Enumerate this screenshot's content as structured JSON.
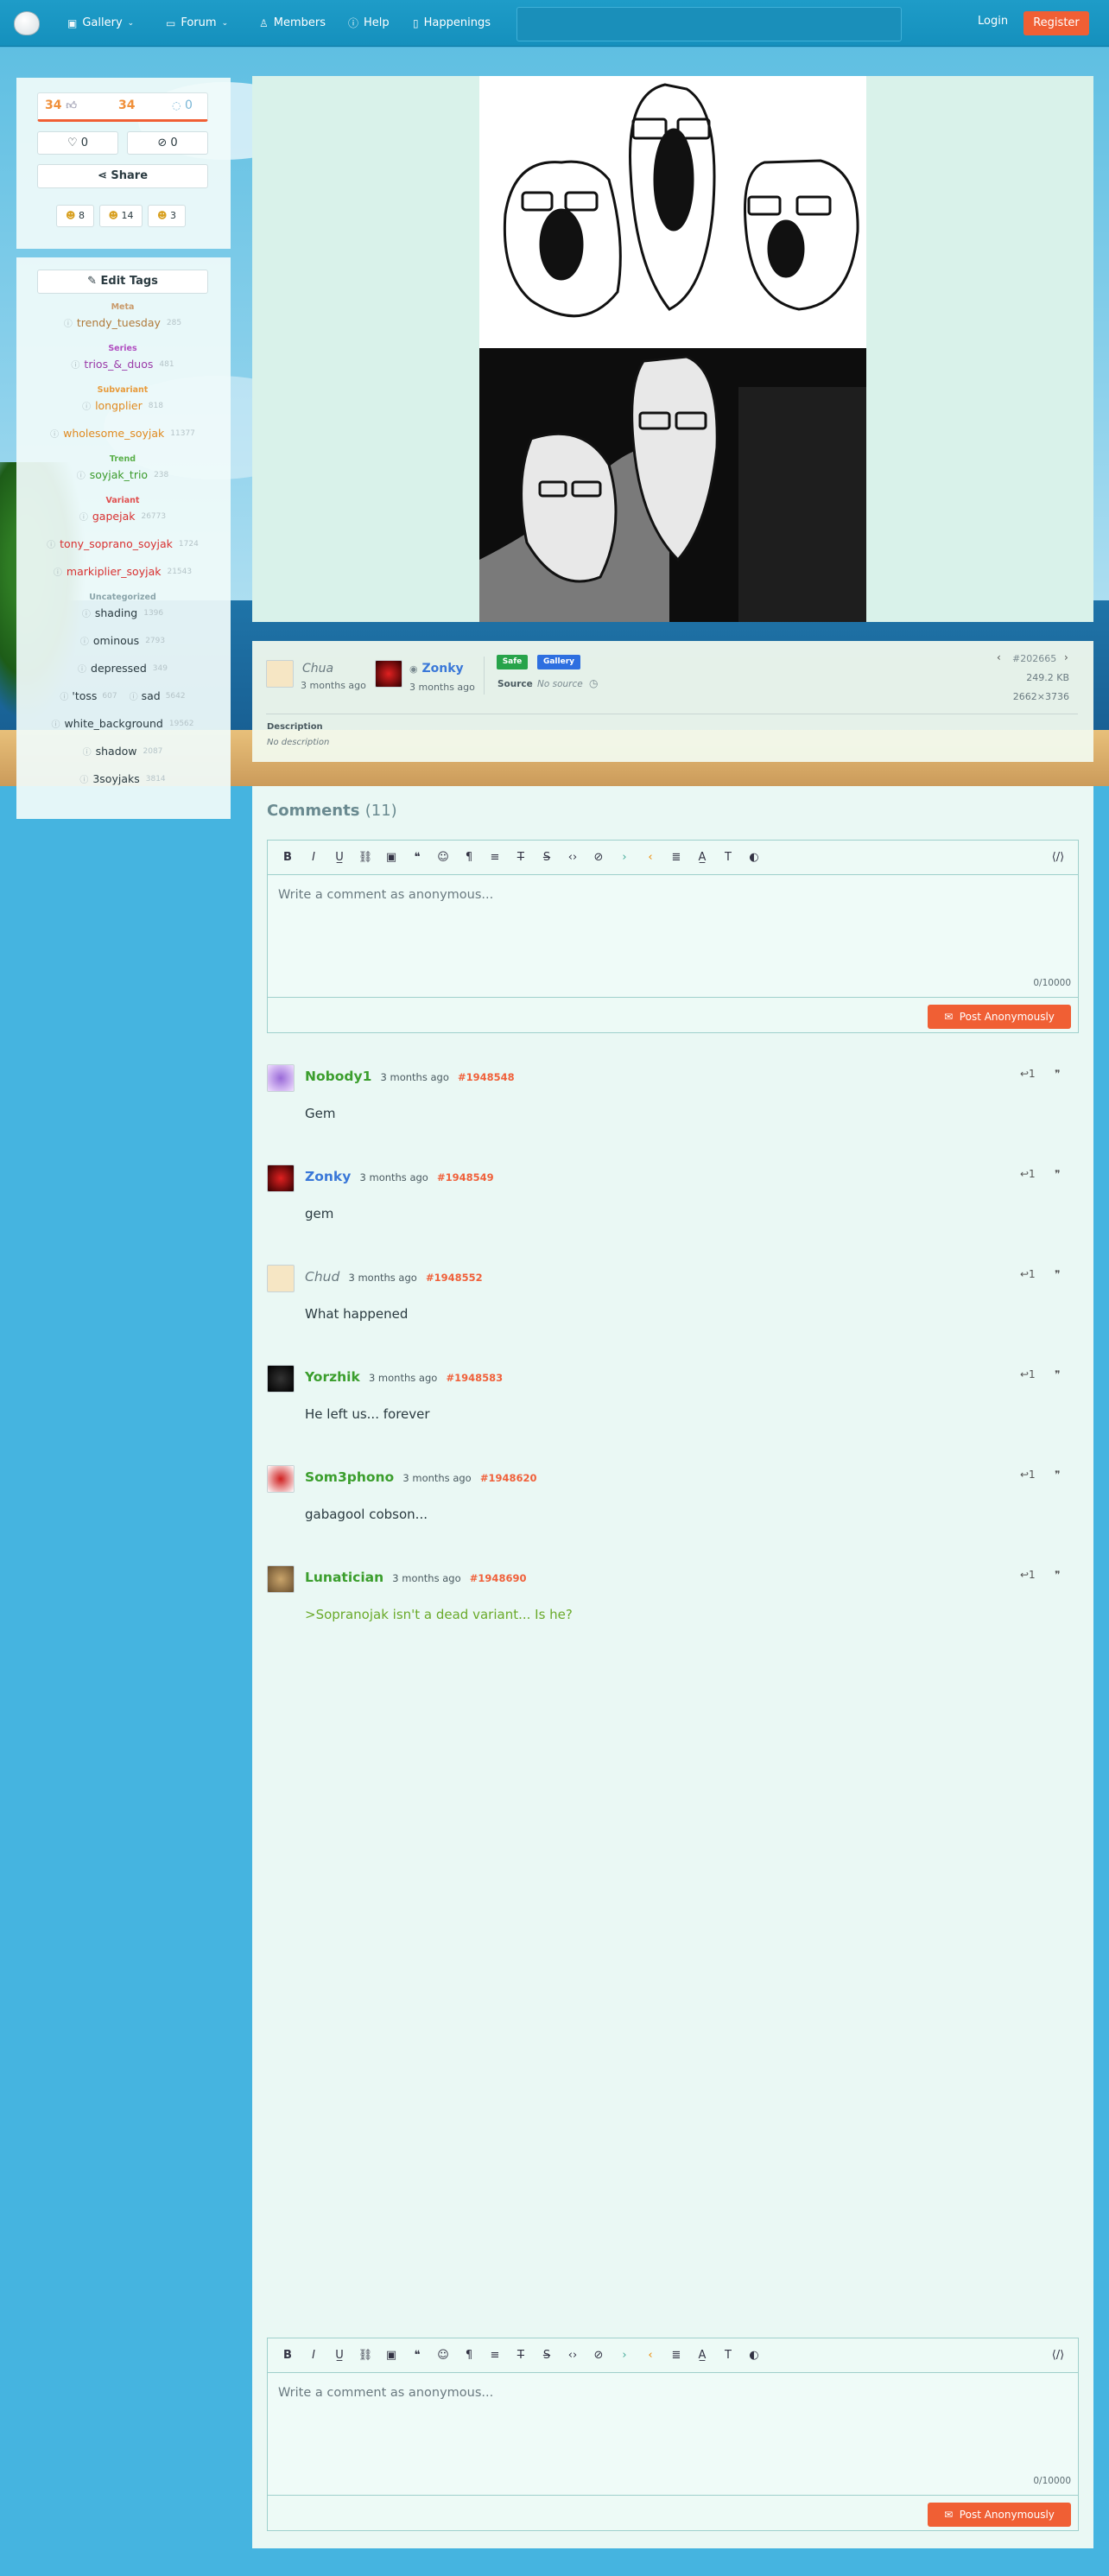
{
  "nav": {
    "gallery": "Gallery",
    "forum": "Forum",
    "members": "Members",
    "help": "Help",
    "happenings": "Happenings",
    "login": "Login",
    "register": "Register"
  },
  "votes": {
    "up": "34",
    "score": "34",
    "down": "0",
    "favorites": "0",
    "hidden": "0",
    "share": "Share"
  },
  "reactions": [
    {
      "icon": "smile-face",
      "count": "8"
    },
    {
      "icon": "laugh-face",
      "count": "14"
    },
    {
      "icon": "cry-face",
      "count": "3"
    }
  ],
  "edit_tags": "Edit Tags",
  "tags": [
    {
      "category": "Meta",
      "color": "#c99a6a"
    },
    {
      "name": "trendy_tuesday",
      "count": "285",
      "color": "#b07a3a"
    },
    {
      "category": "Series",
      "color": "#b14fc1"
    },
    {
      "name": "trios_&_duos",
      "count": "481",
      "color": "#9a3aa8"
    },
    {
      "category": "Subvariant",
      "color": "#e89a3a"
    },
    {
      "name": "longplier",
      "count": "818",
      "color": "#e08a20"
    },
    {
      "name": "wholesome_soyjak",
      "count": "11377",
      "color": "#e08a20"
    },
    {
      "category": "Trend",
      "color": "#5bb04a"
    },
    {
      "name": "soyjak_trio",
      "count": "238",
      "color": "#3a9a2a"
    },
    {
      "category": "Variant",
      "color": "#e05050"
    },
    {
      "name": "gapejak",
      "count": "26773",
      "color": "#d83030"
    },
    {
      "name": "tony_soprano_soyjak",
      "count": "1724",
      "color": "#d83030"
    },
    {
      "name": "markiplier_soyjak",
      "count": "21543",
      "color": "#d83030"
    },
    {
      "category": "Uncategorized",
      "color": "#8aa4aa"
    },
    {
      "name": "shading",
      "count": "1396",
      "color": "#2a3a40"
    },
    {
      "name": "ominous",
      "count": "2793",
      "color": "#2a3a40"
    },
    {
      "name": "depressed",
      "count": "349",
      "color": "#2a3a40"
    }
  ],
  "tags_pair": {
    "left": {
      "name": "'toss",
      "count": "607"
    },
    "right": {
      "name": "sad",
      "count": "5642"
    }
  },
  "tags_tail": [
    {
      "name": "white_background",
      "count": "19562",
      "color": "#2a3a40"
    },
    {
      "name": "shadow",
      "count": "2087",
      "color": "#2a3a40"
    },
    {
      "name": "3soyjaks",
      "count": "3814",
      "color": "#2a3a40"
    }
  ],
  "post": {
    "uploader": "Chua",
    "uploader_time": "3 months ago",
    "approver": "Zonky",
    "approver_time": "3 months ago",
    "badge_safe": "Safe",
    "badge_gallery": "Gallery",
    "source_label": "Source",
    "source_value": "No source",
    "id": "#202665",
    "size": "249.2 KB",
    "dims": "2662×3736",
    "description_label": "Description",
    "description_value": "No description"
  },
  "comments_title": "Comments",
  "comments_count": "(11)",
  "editor": {
    "placeholder": "Write a comment as anonymous...",
    "counter": "0/10000",
    "post_button": "Post Anonymously"
  },
  "comments": [
    {
      "user": "Nobody1",
      "time": "3 months ago",
      "id": "#1948548",
      "text": "Gem",
      "user_color": "#3b9e2d",
      "text_color": "#2a3a40",
      "italic": false
    },
    {
      "user": "Zonky",
      "time": "3 months ago",
      "id": "#1948549",
      "text": "gem",
      "user_color": "#3a78d8",
      "text_color": "#2a3a40",
      "italic": false
    },
    {
      "user": "Chud",
      "time": "3 months ago",
      "id": "#1948552",
      "text": "What happened",
      "user_color": "#6a7a80",
      "text_color": "#2a3a40",
      "italic": true
    },
    {
      "user": "Yorzhik",
      "time": "3 months ago",
      "id": "#1948583",
      "text": "He left us... forever",
      "user_color": "#3b9e2d",
      "text_color": "#2a3a40",
      "italic": false
    },
    {
      "user": "Som3phono",
      "time": "3 months ago",
      "id": "#1948620",
      "text": "gabagool cobson...",
      "user_color": "#3b9e2d",
      "text_color": "#2a3a40",
      "italic": false
    },
    {
      "user": "Lunatician",
      "time": "3 months ago",
      "id": "#1948690",
      "text": ">Sopranojak isn't a dead variant... Is he?",
      "user_color": "#3b9e2d",
      "text_color": "#6aaa2a",
      "italic": false
    }
  ]
}
